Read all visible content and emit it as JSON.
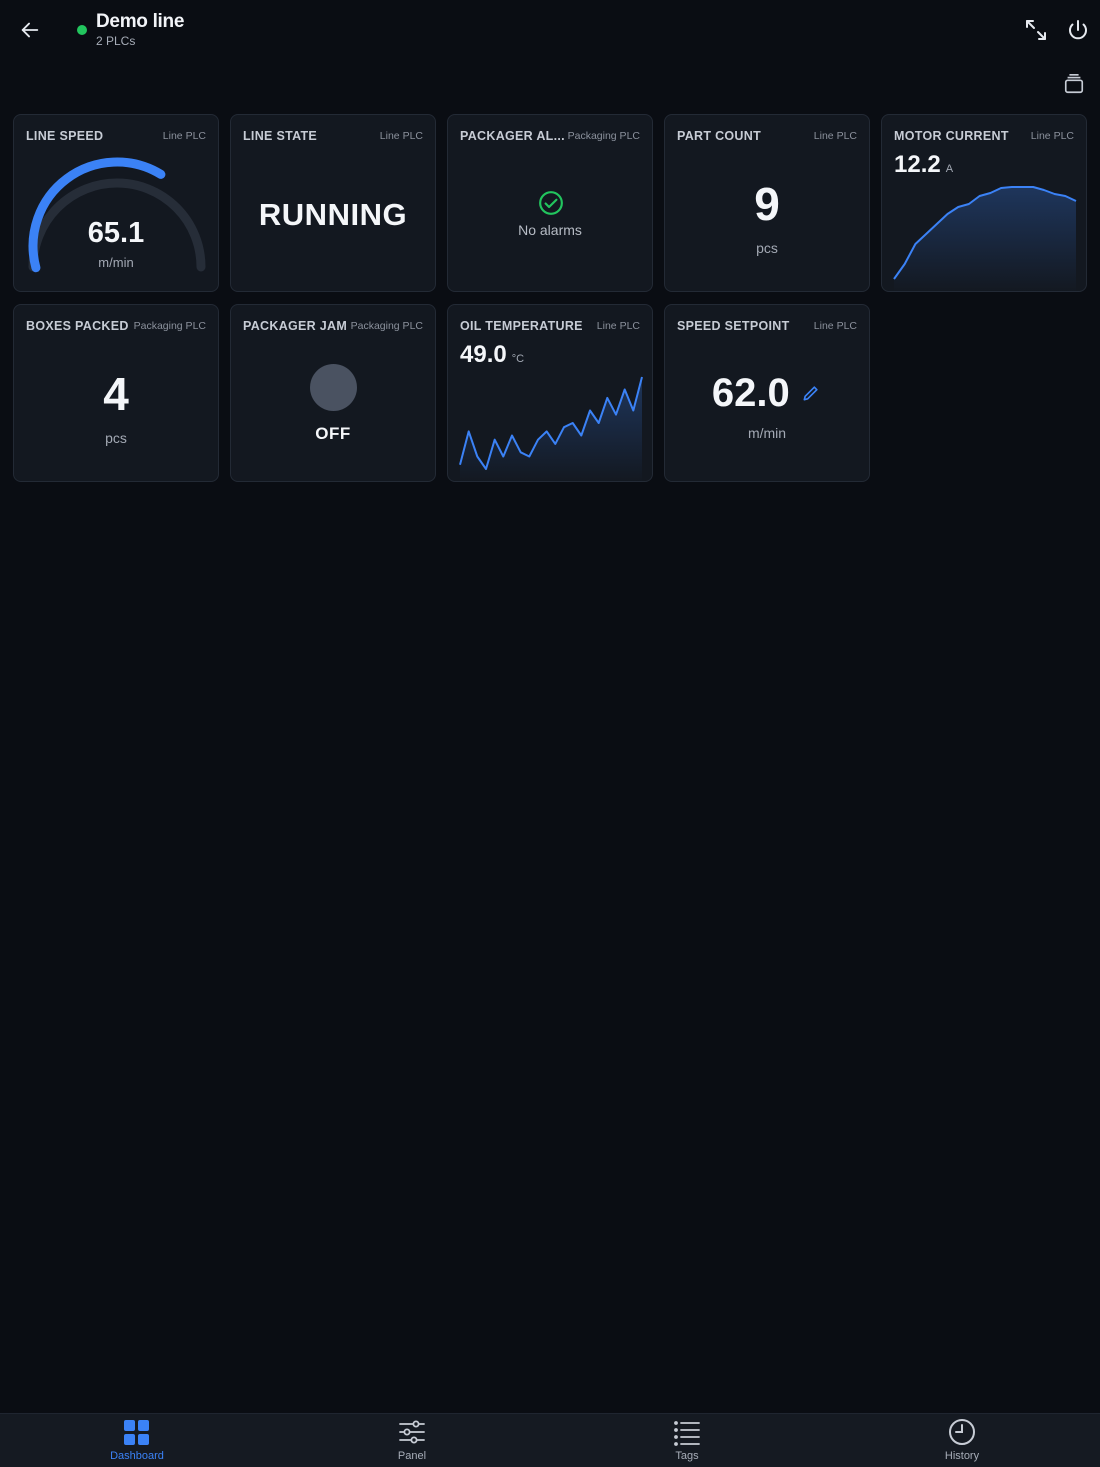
{
  "header": {
    "title": "Demo line",
    "subtitle": "2 PLCs",
    "status_color": "#22c55e",
    "icons": [
      "back-arrow-icon",
      "expand-icon",
      "power-icon",
      "layers-icon"
    ]
  },
  "tiles": {
    "line_speed": {
      "title": "LINE SPEED",
      "source": "Line PLC",
      "value": "65.1",
      "unit": "m/min",
      "gauge_fraction": 0.65
    },
    "line_state": {
      "title": "LINE STATE",
      "source": "Line PLC",
      "value": "RUNNING"
    },
    "packager_alarms": {
      "title": "PACKAGER AL...",
      "source": "Packaging PLC",
      "status": "No alarms",
      "icon": "check-circle-icon"
    },
    "part_count": {
      "title": "PART COUNT",
      "source": "Line PLC",
      "value": "9",
      "unit": "pcs"
    },
    "motor_current": {
      "title": "MOTOR CURRENT",
      "source": "Line PLC",
      "value": "12.2",
      "unit": "A",
      "trend": [
        2,
        3.5,
        5.5,
        6.5,
        7.5,
        8.5,
        9.2,
        9.5,
        10.3,
        10.6,
        11.1,
        11.2,
        11.2,
        11.2,
        10.9,
        10.5,
        10.3,
        9.8
      ]
    },
    "boxes_packed": {
      "title": "BOXES PACKED",
      "source": "Packaging PLC",
      "value": "4",
      "unit": "pcs"
    },
    "packager_jam": {
      "title": "PACKAGER JAM",
      "source": "Packaging PLC",
      "value": "OFF"
    },
    "oil_temperature": {
      "title": "OIL TEMPERATURE",
      "source": "Line PLC",
      "value": "49.0",
      "unit": "°C",
      "trend": [
        40,
        44,
        41,
        39.5,
        43,
        41,
        43.5,
        41.5,
        41,
        43,
        44,
        42.5,
        44.5,
        45,
        43.5,
        46.5,
        45,
        48,
        46,
        49,
        46.5,
        50.5
      ]
    },
    "speed_setpoint": {
      "title": "SPEED SETPOINT",
      "source": "Line PLC",
      "value": "62.0",
      "unit": "m/min",
      "icon": "edit-pencil-icon"
    }
  },
  "nav": {
    "items": [
      {
        "label": "Dashboard",
        "icon": "dashboard-icon",
        "active": true
      },
      {
        "label": "Panel",
        "icon": "sliders-icon",
        "active": false
      },
      {
        "label": "Tags",
        "icon": "list-icon",
        "active": false
      },
      {
        "label": "History",
        "icon": "clock-icon",
        "active": false
      }
    ]
  },
  "colors": {
    "accent": "#3b82f6",
    "success": "#22c55e",
    "card_bg": "#131820",
    "page_bg": "#0a0d13"
  }
}
